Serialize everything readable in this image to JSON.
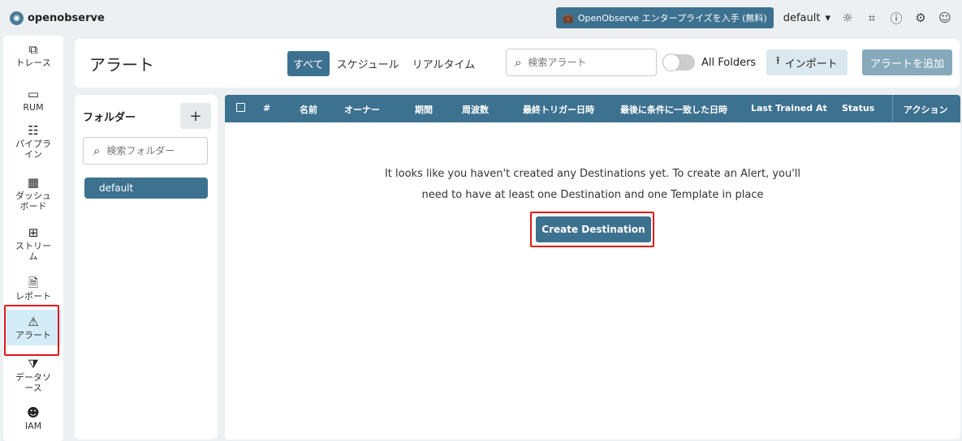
{
  "header": {
    "logo_text": "openobserve",
    "enterprise_label": "OpenObserve エンタープライズを入手 (無料)",
    "org_select": "default",
    "icons": [
      "theme-toggle-icon",
      "slack-icon",
      "help-icon",
      "settings-icon",
      "user-icon"
    ]
  },
  "nav": {
    "items": [
      {
        "label": "トレース",
        "icon": "traces-icon"
      },
      {
        "label": "RUM",
        "icon": "rum-icon"
      },
      {
        "label": "パイプライン",
        "icon": "pipeline-icon"
      },
      {
        "label": "ダッシュボード",
        "icon": "dashboard-icon"
      },
      {
        "label": "ストリーム",
        "icon": "streams-icon"
      },
      {
        "label": "レポート",
        "icon": "reports-icon"
      },
      {
        "label": "アラート",
        "icon": "alert-icon"
      },
      {
        "label": "データソース",
        "icon": "datasource-icon"
      },
      {
        "label": "IAM",
        "icon": "iam-icon"
      }
    ],
    "active": "アラート"
  },
  "page": {
    "title": "アラート",
    "tabs": [
      {
        "label": "すべて",
        "active": true
      },
      {
        "label": "スケジュール",
        "active": false
      },
      {
        "label": "リアルタイム",
        "active": false
      }
    ],
    "search_placeholder": "検索アラート",
    "all_folders_label": "All Folders",
    "import_label": "インポート",
    "add_alert_label": "アラートを追加"
  },
  "folders": {
    "title": "フォルダー",
    "add_symbol": "+",
    "search_placeholder": "検索フォルダー",
    "items": [
      "default"
    ]
  },
  "table": {
    "columns": [
      "#",
      "名前",
      "オーナー",
      "期間",
      "周波数",
      "最終トリガー日時",
      "最後に条件に一致した日時",
      "Last Trained At",
      "Status",
      "アクション"
    ],
    "empty_line1": "It looks like you haven't created any Destinations yet. To create an Alert, you'll",
    "empty_line2": "need to have at least one Destination and one Template in place",
    "create_destination_label": "Create Destination"
  },
  "colors": {
    "primary": "#3d7190",
    "highlight_outline": "#e0191b",
    "active_nav_bg": "#d4ecf7"
  }
}
